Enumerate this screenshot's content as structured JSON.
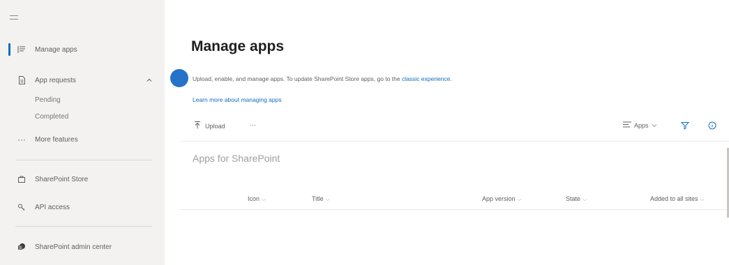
{
  "sidebar": {
    "items": [
      {
        "label": "Manage apps",
        "icon": "list-icon"
      },
      {
        "label": "App requests",
        "icon": "document-icon"
      },
      {
        "label": "More features",
        "icon": "ellipsis-icon"
      },
      {
        "label": "SharePoint Store",
        "icon": "store-icon"
      },
      {
        "label": "API access",
        "icon": "key-icon"
      },
      {
        "label": "SharePoint admin center",
        "icon": "sharepoint-icon"
      }
    ],
    "sub_items": [
      "Pending",
      "Completed"
    ]
  },
  "main": {
    "title": "Manage apps",
    "description_prefix": "Upload, enable, and manage apps. To update SharePoint Store apps, go to the ",
    "description_link": "classic experience",
    "description_suffix": ".",
    "learn_more": "Learn more about managing apps",
    "toolbar": {
      "upload_label": "Upload",
      "more": "···",
      "view_label": "Apps"
    },
    "section_title": "Apps for SharePoint",
    "columns": [
      "Icon",
      "Title",
      "App version",
      "State",
      "Added to all sites"
    ]
  },
  "colors": {
    "sidebar_bg": "#f3f2f1",
    "accent": "#0f6cbd",
    "indicator": "#2672c9"
  }
}
